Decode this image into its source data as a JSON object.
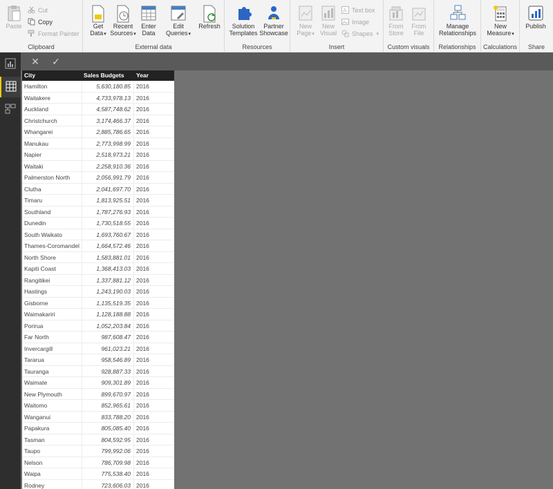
{
  "ribbon": {
    "clipboard": {
      "label": "Clipboard",
      "paste": "Paste",
      "cut": "Cut",
      "copy": "Copy",
      "format_painter": "Format Painter"
    },
    "external_data": {
      "label": "External data",
      "get_data": [
        "Get",
        "Data"
      ],
      "recent_sources": [
        "Recent",
        "Sources"
      ],
      "enter_data": [
        "Enter",
        "Data"
      ],
      "edit_queries": [
        "Edit",
        "Queries"
      ],
      "refresh": "Refresh"
    },
    "resources": {
      "label": "Resources",
      "solution_templates": [
        "Solution",
        "Templates"
      ],
      "partner_showcase": [
        "Partner",
        "Showcase"
      ]
    },
    "insert": {
      "label": "Insert",
      "new_page": [
        "New",
        "Page"
      ],
      "new_visual": [
        "New",
        "Visual"
      ],
      "text_box": "Text box",
      "image": "Image",
      "shapes": "Shapes"
    },
    "custom_visuals": {
      "label": "Custom visuals",
      "from_store": [
        "From",
        "Store"
      ],
      "from_file": [
        "From",
        "File"
      ]
    },
    "relationships": {
      "label": "Relationships",
      "manage": [
        "Manage",
        "Relationships"
      ]
    },
    "calculations": {
      "label": "Calculations",
      "new_measure": [
        "New",
        "Measure"
      ]
    },
    "share": {
      "label": "Share",
      "publish": "Publish"
    }
  },
  "nav": {
    "icons": [
      "report-view-icon",
      "data-view-icon",
      "relationships-view-icon"
    ],
    "active": "data-view-icon"
  },
  "formula_bar": {
    "cancel": "✕",
    "commit": "✓"
  },
  "table": {
    "columns": [
      "City",
      "Sales Budgets",
      "Year"
    ],
    "rows": [
      [
        "Hamilton",
        "5,630,180.85",
        "2016"
      ],
      [
        "Waitakere",
        "4,733,978.13",
        "2016"
      ],
      [
        "Auckland",
        "4,587,748.62",
        "2016"
      ],
      [
        "Christchurch",
        "3,174,466.37",
        "2016"
      ],
      [
        "Whangarei",
        "2,885,786.65",
        "2016"
      ],
      [
        "Manukau",
        "2,773,998.99",
        "2016"
      ],
      [
        "Napier",
        "2,518,973.21",
        "2016"
      ],
      [
        "Waitaki",
        "2,258,910.36",
        "2016"
      ],
      [
        "Palmerston North",
        "2,056,991.79",
        "2016"
      ],
      [
        "Clutha",
        "2,041,697.70",
        "2016"
      ],
      [
        "Timaru",
        "1,813,925.51",
        "2016"
      ],
      [
        "Southland",
        "1,787,276.93",
        "2016"
      ],
      [
        "Dunedin",
        "1,730,518.55",
        "2016"
      ],
      [
        "South Waikato",
        "1,693,760.67",
        "2016"
      ],
      [
        "Thames-Coromandel",
        "1,664,572.46",
        "2016"
      ],
      [
        "North Shore",
        "1,583,881.01",
        "2016"
      ],
      [
        "Kapiti Coast",
        "1,368,413.03",
        "2016"
      ],
      [
        "Rangitikei",
        "1,337,881.12",
        "2016"
      ],
      [
        "Hastings",
        "1,243,190.03",
        "2016"
      ],
      [
        "Gisborne",
        "1,135,519.35",
        "2016"
      ],
      [
        "Waimakariri",
        "1,128,188.88",
        "2016"
      ],
      [
        "Porirua",
        "1,052,203.84",
        "2016"
      ],
      [
        "Far North",
        "987,608.47",
        "2016"
      ],
      [
        "Invercargill",
        "961,023.21",
        "2016"
      ],
      [
        "Tararua",
        "958,546.89",
        "2016"
      ],
      [
        "Tauranga",
        "928,887.33",
        "2016"
      ],
      [
        "Waimate",
        "909,301.89",
        "2016"
      ],
      [
        "New Plymouth",
        "899,670.97",
        "2016"
      ],
      [
        "Waitomo",
        "852,965.61",
        "2016"
      ],
      [
        "Wanganui",
        "833,788.20",
        "2016"
      ],
      [
        "Papakura",
        "805,085.40",
        "2016"
      ],
      [
        "Tasman",
        "804,592.95",
        "2016"
      ],
      [
        "Taupo",
        "799,992.06",
        "2016"
      ],
      [
        "Nelson",
        "786,709.98",
        "2016"
      ],
      [
        "Waipa",
        "775,538.40",
        "2016"
      ],
      [
        "Rodney",
        "723,606.03",
        "2016"
      ]
    ]
  }
}
